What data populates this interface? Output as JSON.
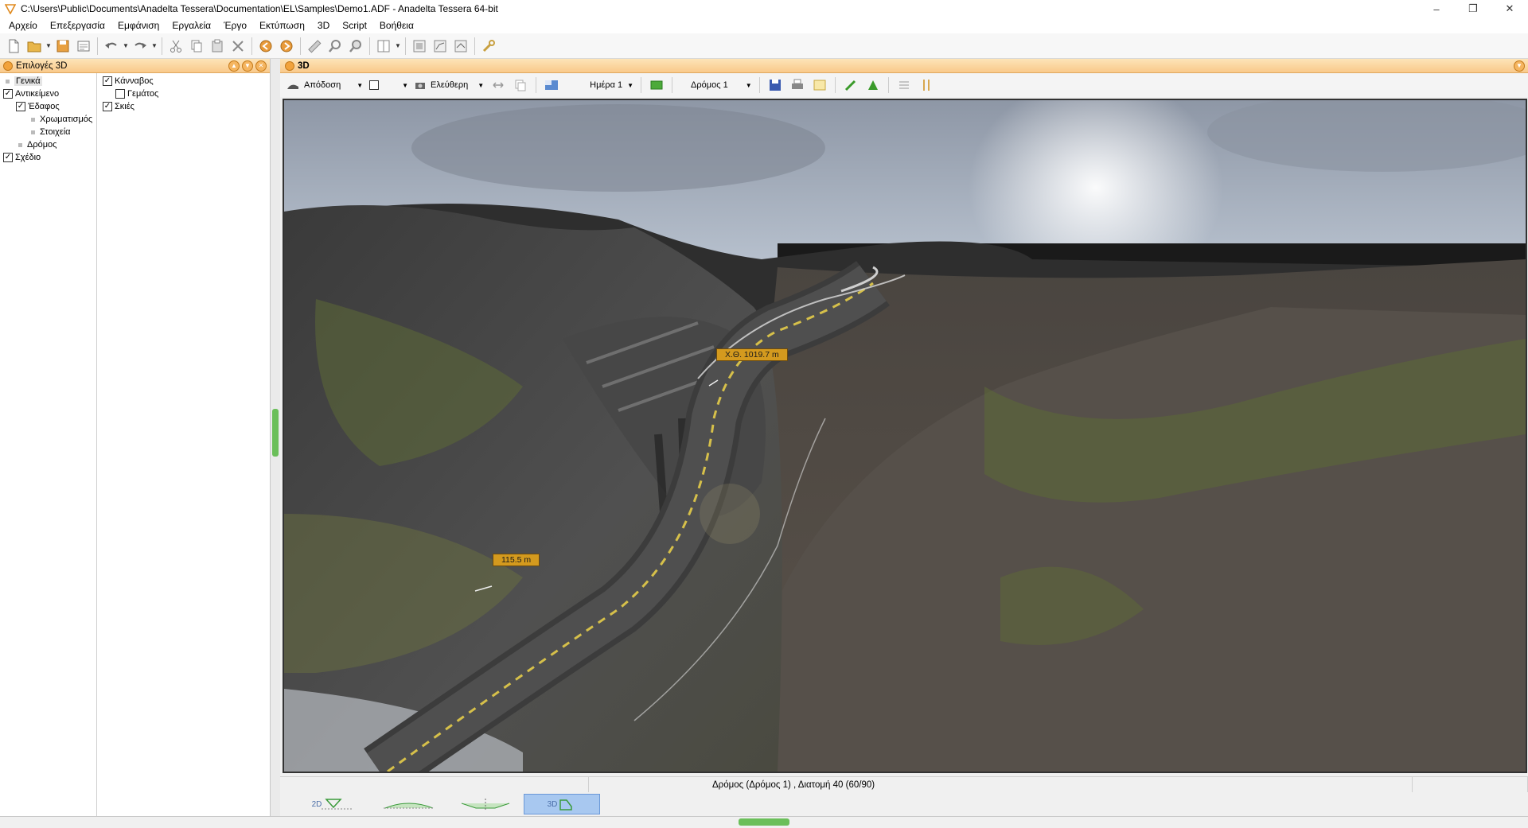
{
  "window": {
    "title": "C:\\Users\\Public\\Documents\\Anadelta Tessera\\Documentation\\EL\\Samples\\Demo1.ADF - Anadelta Tessera 64-bit",
    "minimize_icon": "minimize-icon",
    "maximize_icon": "restore-icon",
    "close_icon": "close-icon"
  },
  "menu": [
    "Αρχείο",
    "Επεξεργασία",
    "Εμφάνιση",
    "Εργαλεία",
    "Έργο",
    "Εκτύπωση",
    "3D",
    "Script",
    "Βοήθεια"
  ],
  "left_panel": {
    "title": "Επιλογές 3D",
    "tree": [
      {
        "label": "Γενικά",
        "kind": "dot",
        "selected": true
      },
      {
        "label": "Αντικείμενο",
        "kind": "check",
        "checked": true
      },
      {
        "label": "Έδαφος",
        "kind": "check",
        "checked": true
      },
      {
        "label": "Χρωματισμός",
        "kind": "dot"
      },
      {
        "label": "Στοιχεία",
        "kind": "dot"
      },
      {
        "label": "Δρόμος",
        "kind": "dot"
      },
      {
        "label": "Σχέδιο",
        "kind": "check",
        "checked": true
      }
    ],
    "options": [
      {
        "label": "Κάνναβος",
        "checked": true
      },
      {
        "label": "Γεμάτος",
        "checked": false
      },
      {
        "label": "Σκιές",
        "checked": true
      }
    ]
  },
  "view": {
    "title": "3D",
    "render_mode": "Απόδοση",
    "camera_mode": "Ελεύθερη",
    "day": "Ημέρα 1",
    "road": "Δρόμος 1",
    "label_chainage_end": "Χ.Θ. 1019.7 m",
    "label_chainage_start": "115.5 m",
    "status": "Δρόμος (Δρόμος 1) , Διατομή 40 (60/90)"
  },
  "tabs": [
    {
      "label": "2D",
      "active": false
    },
    {
      "label": "",
      "active": false
    },
    {
      "label": "",
      "active": false
    },
    {
      "label": "3D",
      "active": true
    }
  ],
  "colors": {
    "panel_header": "#f9c98a",
    "label_fill": "#d49a1e",
    "active_tab": "#a8c8f0",
    "splitter_grip": "#6bbf5a"
  }
}
